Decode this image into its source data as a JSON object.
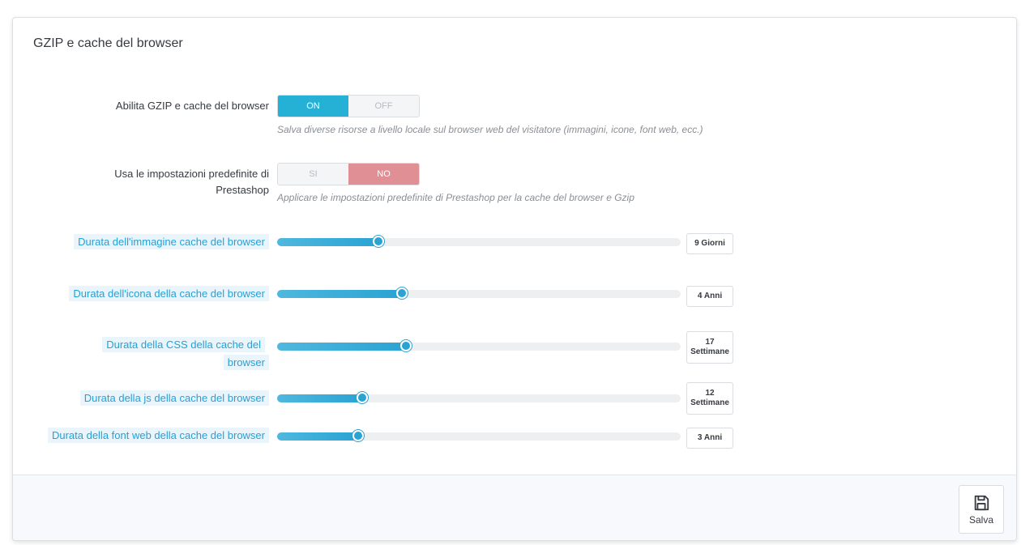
{
  "panel": {
    "title": "GZIP e cache del browser"
  },
  "gzip": {
    "label": "Abilita GZIP e cache del browser",
    "on_label": "ON",
    "off_label": "OFF",
    "selected": "ON",
    "help": "Salva diverse risorse a livello locale sul browser web del visitatore (immagini, icone, font web, ecc.)"
  },
  "defaults": {
    "label": "Usa le impostazioni predefinite di Prestashop",
    "si_label": "SI",
    "no_label": "NO",
    "selected": "NO",
    "help": "Applicare le impostazioni predefinite di Prestashop per la cache del browser e Gzip"
  },
  "sliders": [
    {
      "label": "Durata dell'immagine cache del browser",
      "value_line1": "9 Giorni",
      "value_line2": "",
      "level_fraction": 0.25
    },
    {
      "label": "Durata dell'icona della cache del browser",
      "value_line1": "4 Anni",
      "value_line2": "",
      "level_fraction": 0.31
    },
    {
      "label": "Durata della CSS della cache del browser",
      "value_line1": "17",
      "value_line2": "Settimane",
      "level_fraction": 0.32
    },
    {
      "label": "Durata della js della cache del browser",
      "value_line1": "12",
      "value_line2": "Settimane",
      "level_fraction": 0.21
    },
    {
      "label": "Durata della font web della cache del browser",
      "value_line1": "3 Anni",
      "value_line2": "",
      "level_fraction": 0.2
    }
  ],
  "footer": {
    "save_label": "Salva",
    "save_icon": "floppy-disk-icon"
  },
  "colors": {
    "accent": "#25b1d6",
    "danger": "#e08f95",
    "label_blue": "#25a1d6"
  }
}
